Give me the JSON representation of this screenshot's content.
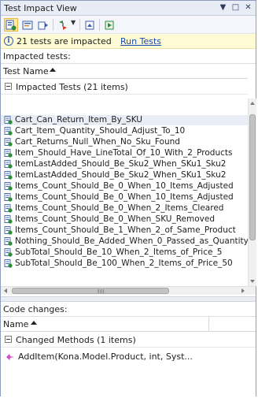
{
  "window": {
    "title": "Test Impact View"
  },
  "titlebar": {
    "dropdown_glyph": "▼",
    "pin_glyph": "□",
    "close_glyph": "✕"
  },
  "toolbar": {
    "buttons": [
      {
        "name": "impacted-tests-icon",
        "active": true
      },
      {
        "name": "code-changes-icon",
        "active": false
      },
      {
        "name": "tests-affected-icon",
        "active": false
      },
      {
        "name": "filter-icon",
        "active": false
      },
      {
        "name": "refresh-icon",
        "active": false
      },
      {
        "name": "settings-icon",
        "active": false
      }
    ],
    "dropdown_glyph": "▼"
  },
  "info": {
    "icon": "info-icon",
    "icon_glyph": "i",
    "message": "21 tests are impacted",
    "link": "Run Tests"
  },
  "impacted": {
    "label": "Impacted tests:",
    "column_header": "Test Name",
    "group": "Impacted Tests (21 items)",
    "tests": [
      "Cart_Can_Return_Item_By_SKU",
      "Cart_Item_Quantity_Should_Adjust_To_10",
      "Cart_Returns_Null_When_No_Sku_Found",
      "Item_Should_Have_LineTotal_Of_10_With_2_Products",
      "ItemLastAdded_Should_Be_Sku2_When_SKu1_Sku2",
      "ItemLastAdded_Should_Be_Sku2_When_SKu1_Sku2",
      "Items_Count_Should_Be_0_When_10_Items_Adjusted",
      "Items_Count_Should_Be_0_When_10_Items_Adjusted",
      "Items_Count_Should_Be_0_When_2_Items_Cleared",
      "Items_Count_Should_Be_0_When_SKU_Removed",
      "Items_Count_Should_Be_1_When_2_of_Same_Product",
      "Nothing_Should_Be_Added_When_0_Passed_as_Quantity",
      "SubTotal_Should_Be_10_When_2_Items_of_Price_5",
      "SubTotal_Should_Be_100_When_2_Items_of_Price_50"
    ],
    "hscroll_grip": "III"
  },
  "code_changes": {
    "label": "Code changes:",
    "column_header": "Name",
    "group": "Changed Methods (1 items)",
    "methods": [
      {
        "icon": "method-icon",
        "name": "AddItem(Kona.Model.Product, int, Syst..."
      }
    ]
  },
  "colors": {
    "accent": "#3b62a8",
    "link": "#1a49b3",
    "info_bg": "#fffbd4",
    "method_icon": "#d050c8"
  }
}
